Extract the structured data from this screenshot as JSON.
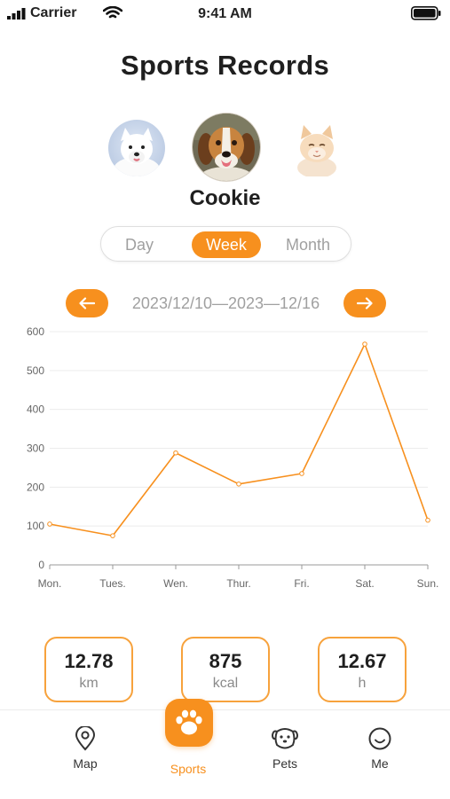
{
  "status_bar": {
    "carrier": "Carrier",
    "time": "9:41 AM"
  },
  "header": {
    "title": "Sports Records"
  },
  "pets": {
    "selected_name": "Cookie",
    "avatars": [
      {
        "name": "samoyed",
        "selected": false
      },
      {
        "name": "beagle",
        "selected": true
      },
      {
        "name": "cat",
        "selected": false
      }
    ]
  },
  "range_tabs": [
    {
      "label": "Day",
      "active": false
    },
    {
      "label": "Week",
      "active": true
    },
    {
      "label": "Month",
      "active": false
    }
  ],
  "date_nav": {
    "range": "2023/12/10—2023—12/16",
    "prev_icon": "←",
    "next_icon": "→"
  },
  "chart_data": {
    "type": "line",
    "categories": [
      "Mon.",
      "Tues.",
      "Wen.",
      "Thur.",
      "Fri.",
      "Sat.",
      "Sun."
    ],
    "series": [
      {
        "values": [
          105,
          75,
          288,
          208,
          235,
          568,
          115
        ]
      }
    ],
    "ylim": [
      0,
      600
    ],
    "yticks": [
      0,
      100,
      200,
      300,
      400,
      500,
      600
    ],
    "grid": true,
    "line_color": "#f7901e"
  },
  "stats": [
    {
      "value": "12.78",
      "unit": "km"
    },
    {
      "value": "875",
      "unit": "kcal"
    },
    {
      "value": "12.67",
      "unit": "h"
    }
  ],
  "tab_bar": {
    "items": [
      {
        "label": "Map",
        "icon": "map-pin-icon",
        "active": false
      },
      {
        "label": "Sports",
        "icon": "paw-icon",
        "active": true
      },
      {
        "label": "Pets",
        "icon": "dog-face-icon",
        "active": false
      },
      {
        "label": "Me",
        "icon": "smile-icon",
        "active": false
      }
    ]
  },
  "colors": {
    "accent": "#f7901e",
    "muted_text": "#a0a0a0"
  }
}
